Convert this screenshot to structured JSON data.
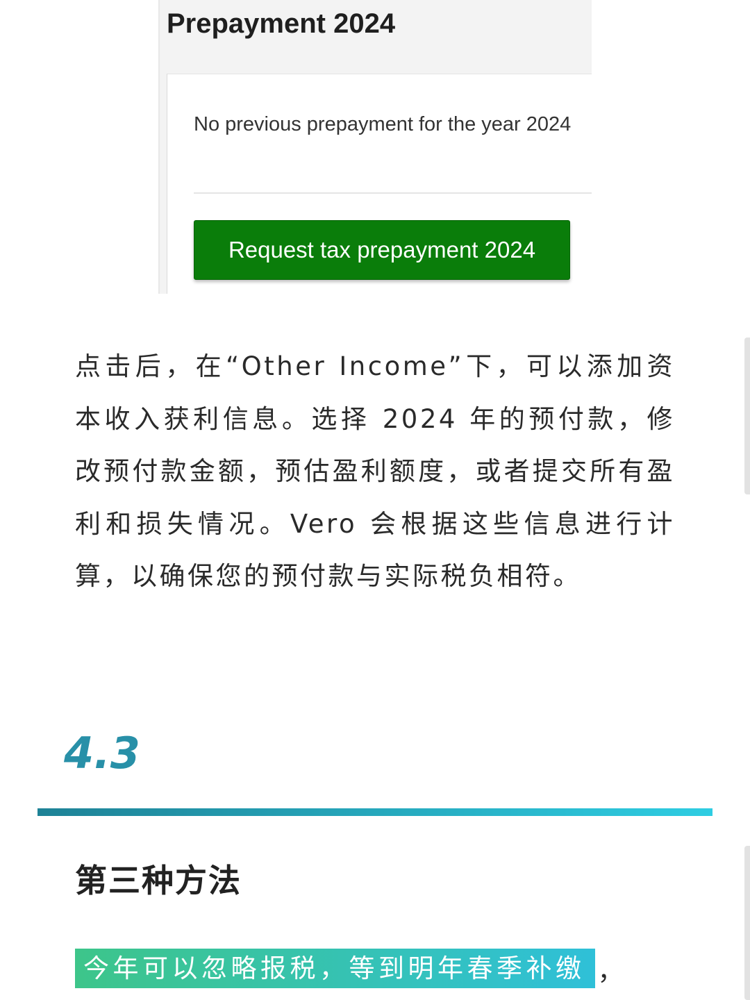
{
  "screenshot": {
    "title": "Prepayment 2024",
    "notice": "No previous prepayment for the year 2024",
    "button_label": "Request tax prepayment 2024",
    "button_color": "#0a7d0a"
  },
  "article": {
    "paragraph": "点击后，在“Other Income”下，可以添加资本收入获利信息。选择 2024 年的预付款，修改预付款金额，预估盈利额度，或者提交所有盈利和损失情况。Vero 会根据这些信息进行计算，以确保您的预付款与实际税负相符。",
    "section_number": "4.3",
    "section_heading": "第三种方法",
    "highlight_text": "今年可以忽略报税，等到明年春季补缴",
    "highlight_tail": "，"
  },
  "colors": {
    "section_accent": "#2890a8",
    "rule_gradient_start": "#1e8296",
    "rule_gradient_end": "#2ecde2",
    "highlight_gradient_start": "#3dc58a",
    "highlight_gradient_end": "#2fc0d8"
  }
}
